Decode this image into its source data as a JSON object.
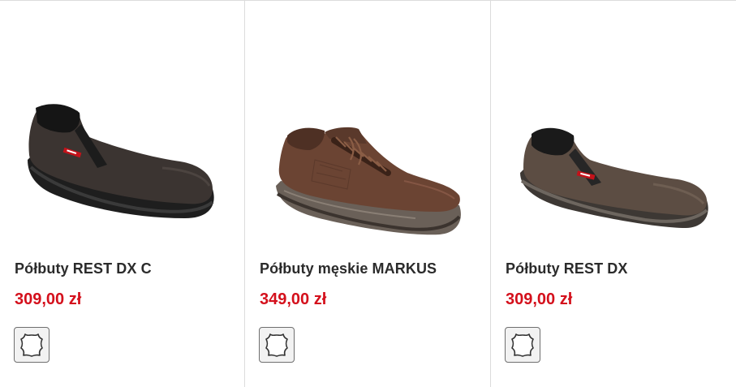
{
  "products": [
    {
      "name": "Półbuty REST DX C",
      "price": "309,00 zł",
      "material_icon": "leather-icon"
    },
    {
      "name": "Półbuty męskie MARKUS",
      "price": "349,00 zł",
      "material_icon": "leather-icon"
    },
    {
      "name": "Półbuty REST DX",
      "price": "309,00 zł",
      "material_icon": "leather-icon"
    }
  ],
  "colors": {
    "price": "#d4101c",
    "title": "#2b2b2b",
    "divider": "#dcdcdc"
  }
}
